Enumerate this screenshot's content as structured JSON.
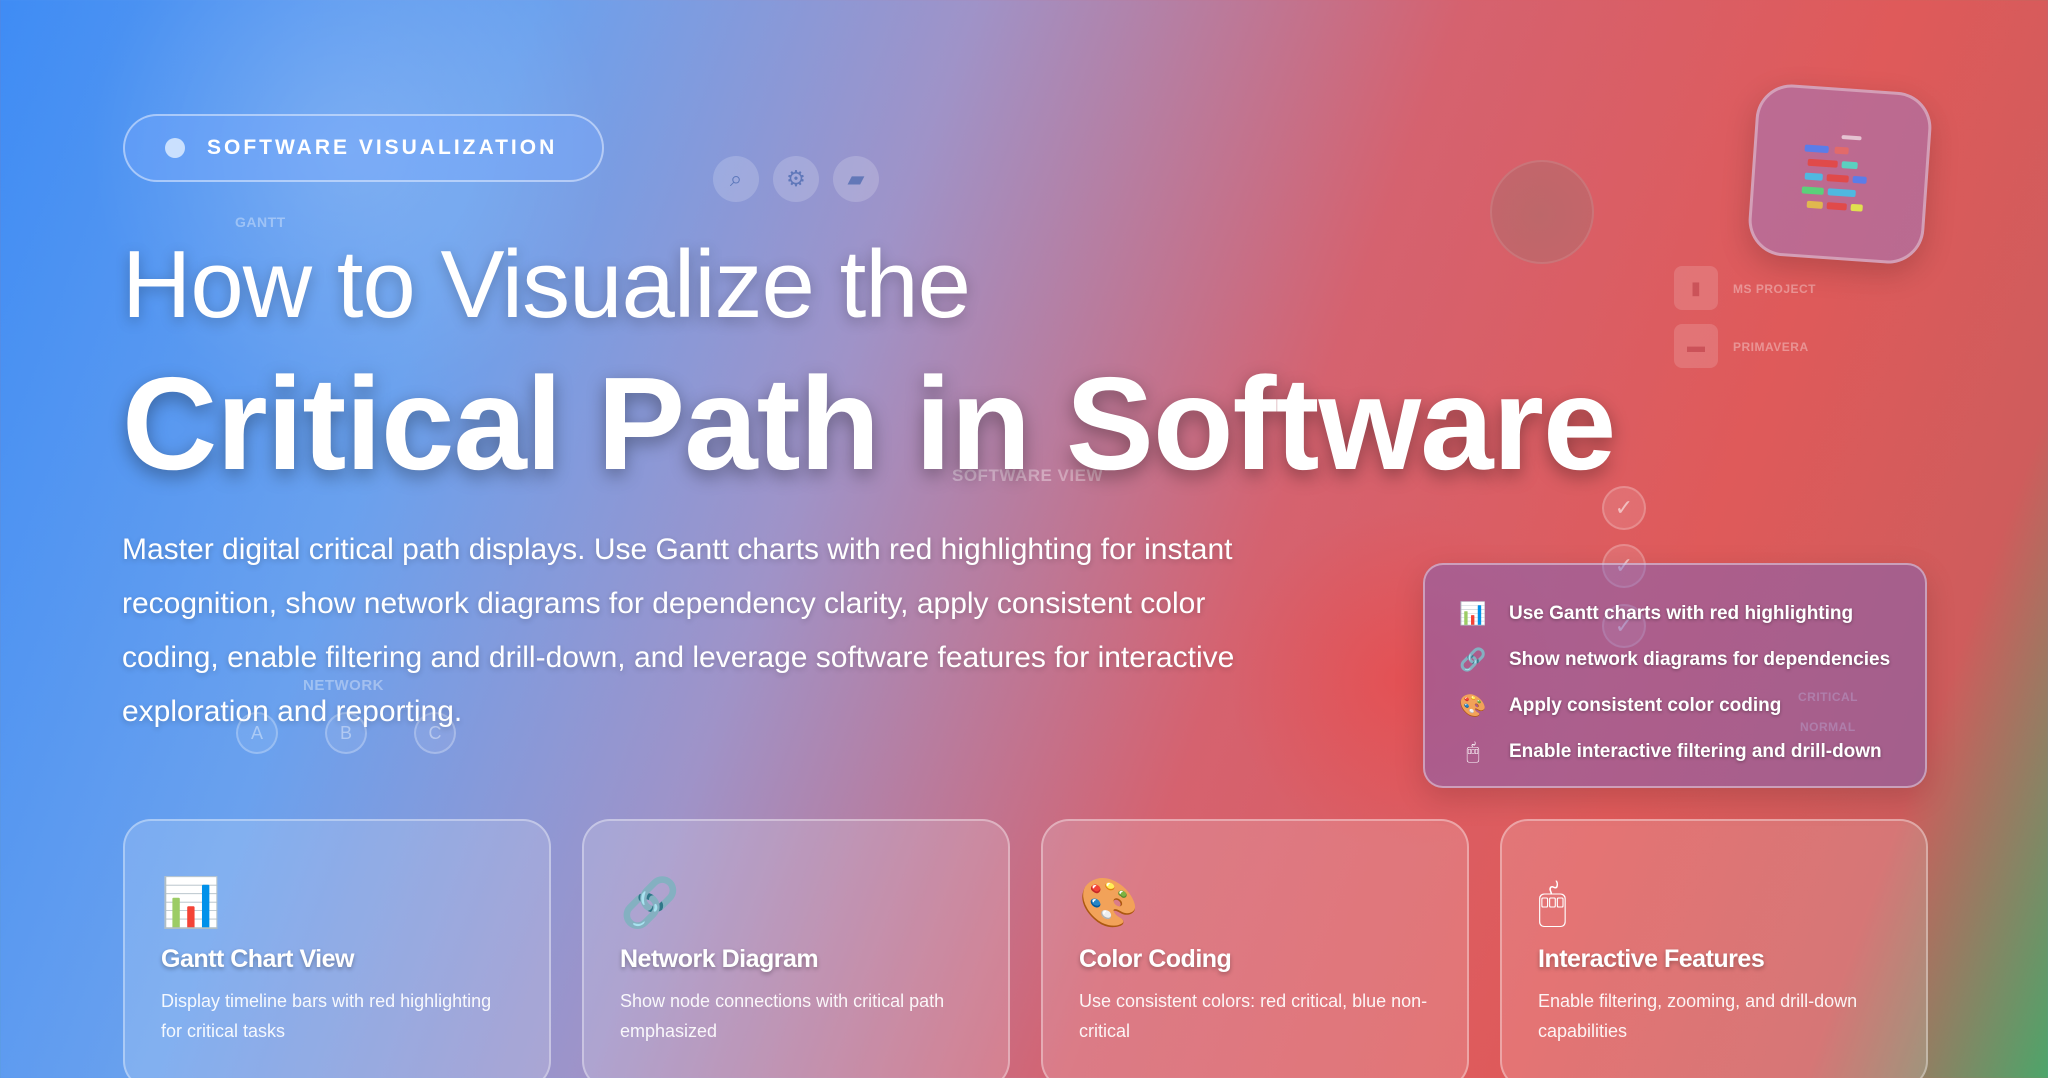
{
  "badge": {
    "label": "SOFTWARE VISUALIZATION"
  },
  "hero": {
    "title_line1": "How to Visualize the",
    "title_line2": "Critical Path in Software",
    "description": "Master digital critical path displays. Use Gantt charts with red highlighting for instant recognition, show network diagrams for dependency clarity, apply consistent color coding, enable filtering and drill-down, and leverage software features for interactive exploration and reporting."
  },
  "background_labels": {
    "gantt": "GANTT",
    "software_view": "SOFTWARE VIEW",
    "network": "NETWORK",
    "node_a": "A",
    "node_b": "B",
    "node_c": "C",
    "ms_project": "MS PROJECT",
    "primavera": "PRIMAVERA",
    "critical": "CRITICAL",
    "normal": "NORMAL"
  },
  "tips": [
    {
      "icon": "bar-chart-icon",
      "glyph": "📊",
      "text": "Use Gantt charts with red highlighting"
    },
    {
      "icon": "link-icon",
      "glyph": "🔗",
      "text": "Show network diagrams for dependencies"
    },
    {
      "icon": "palette-icon",
      "glyph": "🎨",
      "text": "Apply consistent color coding"
    },
    {
      "icon": "mouse-icon",
      "glyph": "🖱",
      "text": "Enable interactive filtering and drill-down"
    }
  ],
  "cards": [
    {
      "icon": "bar-chart-icon",
      "glyph": "📊",
      "title": "Gantt Chart View",
      "description": "Display timeline bars with red highlighting for critical tasks"
    },
    {
      "icon": "link-icon",
      "glyph": "🔗",
      "title": "Network Diagram",
      "description": "Show node connections with critical path emphasized"
    },
    {
      "icon": "palette-icon",
      "glyph": "🎨",
      "title": "Color Coding",
      "description": "Use consistent colors: red critical, blue non-critical"
    },
    {
      "icon": "mouse-icon",
      "glyph": "🖱",
      "title": "Interactive Features",
      "description": "Enable filtering, zooming, and drill-down capabilities"
    }
  ],
  "colors": {
    "gradient_start": "#3f8cf4",
    "gradient_mid": "#d5626f",
    "gradient_end": "#4da56a"
  }
}
